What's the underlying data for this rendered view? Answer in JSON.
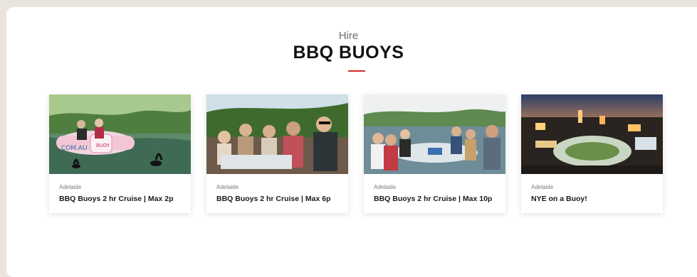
{
  "section": {
    "subtitle": "Hire",
    "title": "BBQ BUOYS"
  },
  "cards": [
    {
      "location": "Adelaide",
      "name": "BBQ Buoys 2 hr Cruise | Max 2p",
      "image": "buoy-on-river-photo"
    },
    {
      "location": "Adelaide",
      "name": "BBQ Buoys 2 hr Cruise | Max 6p",
      "image": "friends-on-buoy-photo"
    },
    {
      "location": "Adelaide",
      "name": "BBQ Buoys 2 hr Cruise | Max 10p",
      "image": "group-cruise-photo"
    },
    {
      "location": "Adelaide",
      "name": "NYE on a Buoy!",
      "image": "city-night-photo"
    }
  ]
}
